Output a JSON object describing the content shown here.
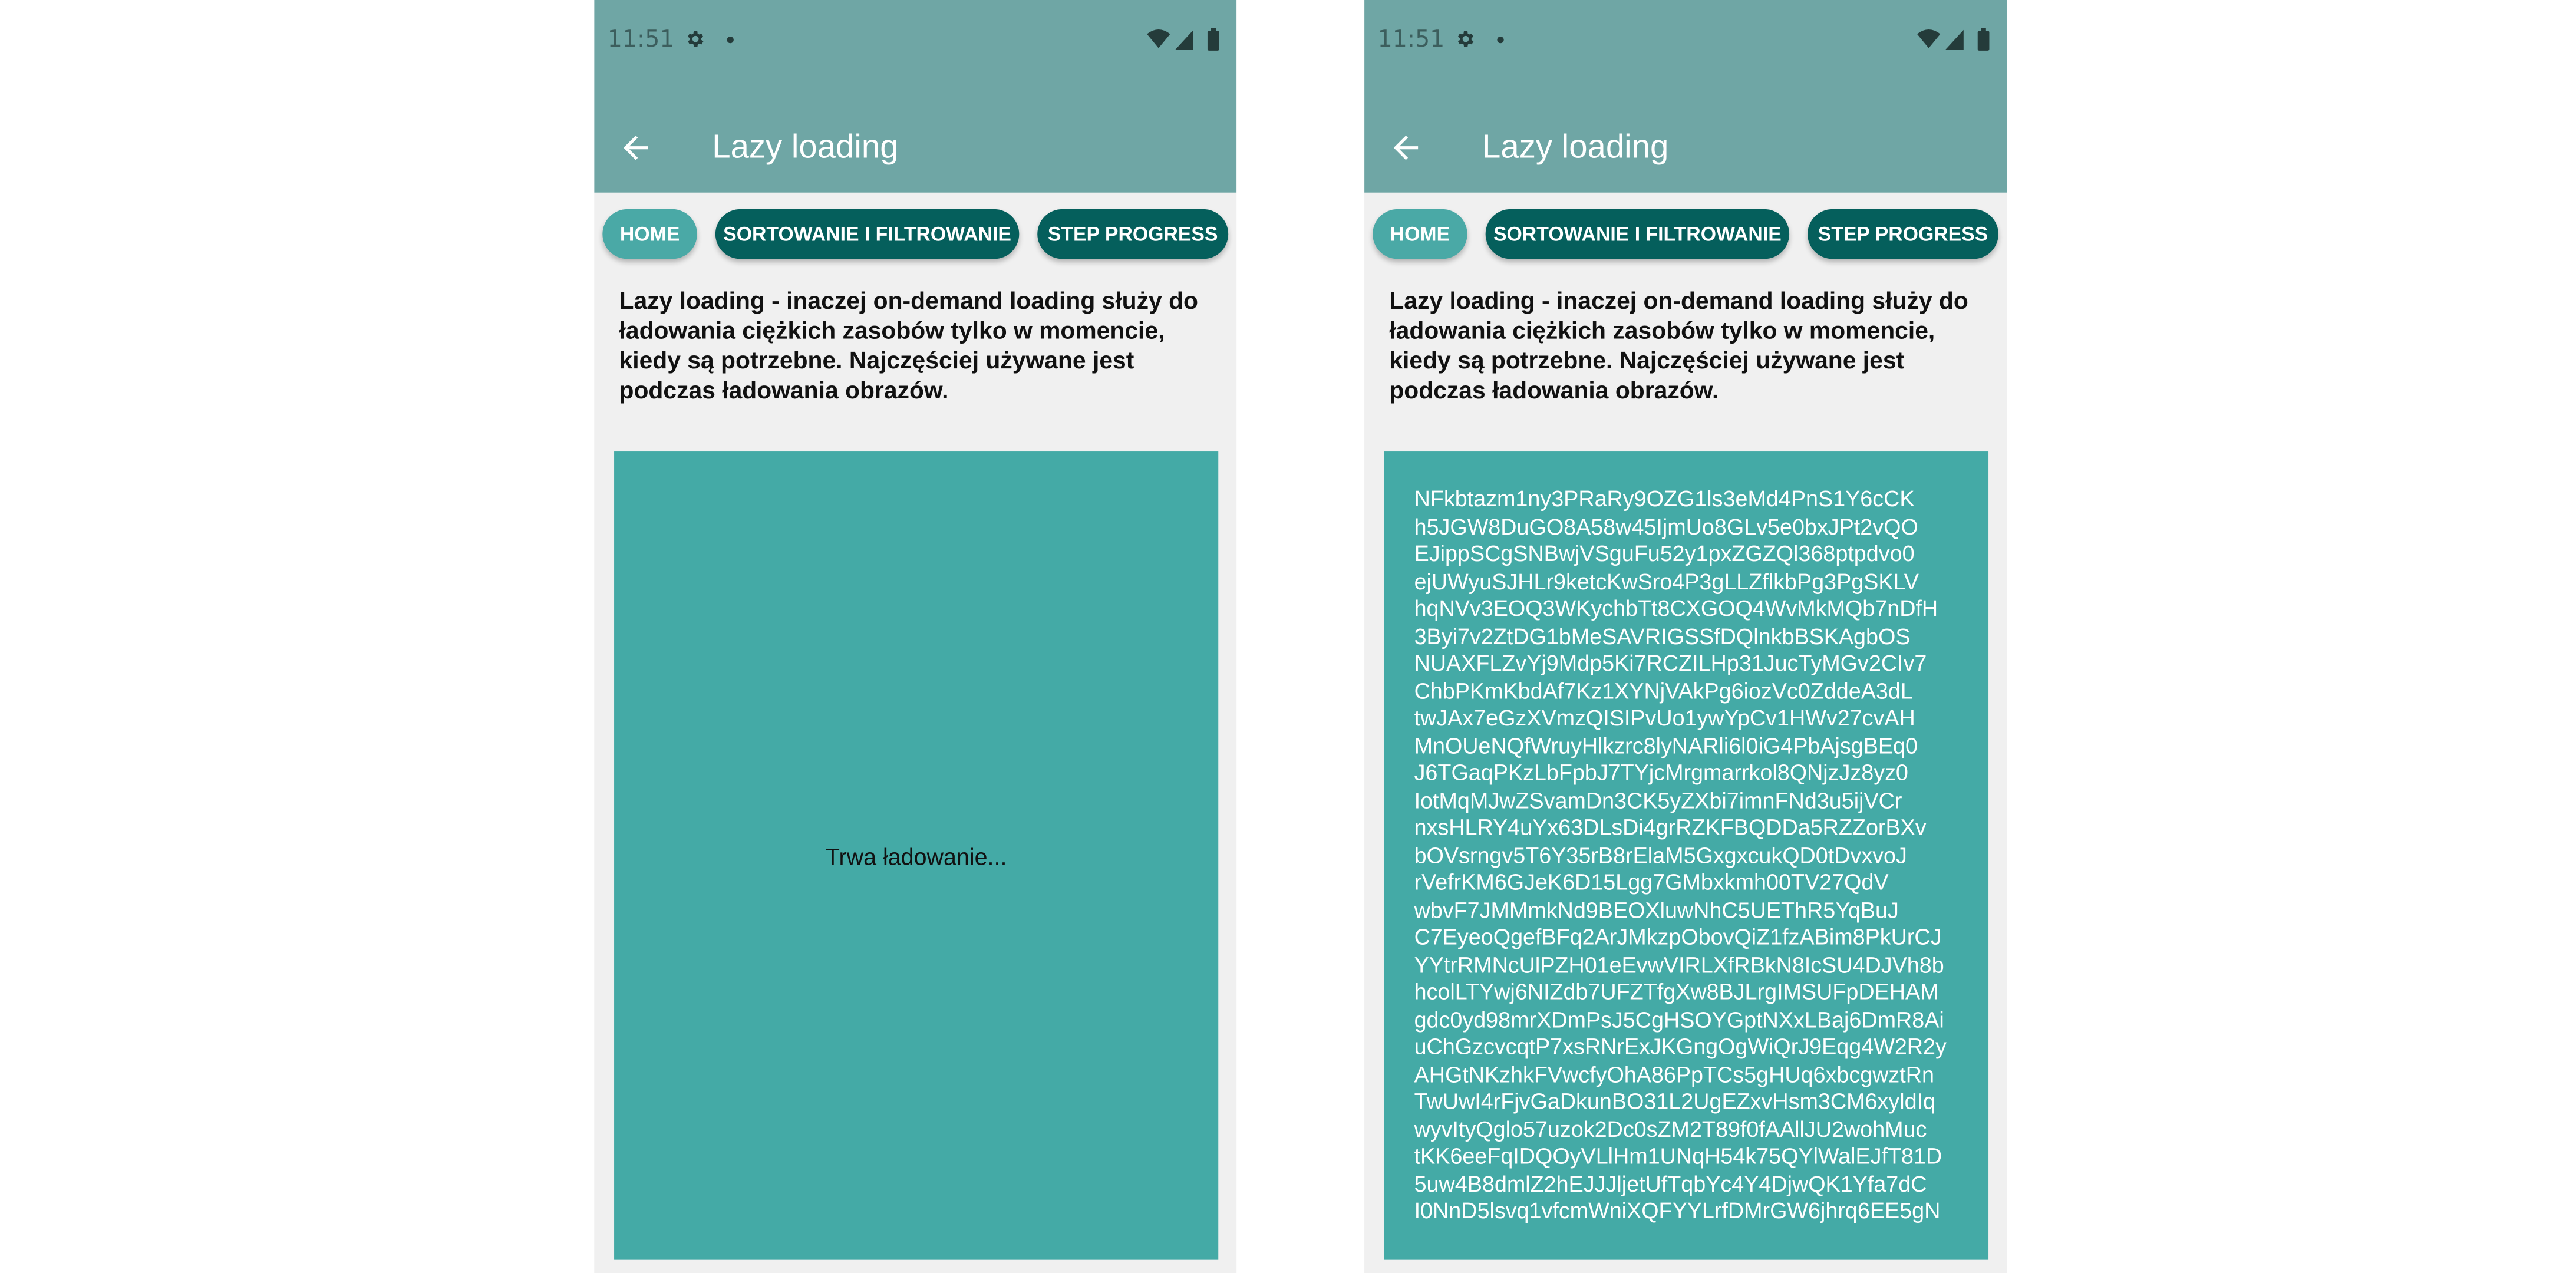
{
  "colors": {
    "status_bar": "#6fa6a5",
    "app_bar": "#6fa6a5",
    "chip_active": "#4aa9a6",
    "chip_inactive": "#055f5c",
    "content_box": "#44aaa6",
    "background": "#f0f0f0"
  },
  "icons": {
    "gear": "gear-icon",
    "notification_dot": "notification-dot-icon",
    "wifi": "wifi-icon",
    "signal": "signal-icon",
    "battery": "battery-icon",
    "back": "arrow-back-icon"
  },
  "left_phone": {
    "status": {
      "time": "11:51"
    },
    "app_bar": {
      "title": "Lazy loading"
    },
    "chips": [
      {
        "label": "HOME",
        "active": true
      },
      {
        "label": "SORTOWANIE I FILTROWANIE",
        "active": false
      },
      {
        "label": "STEP PROGRESS",
        "active": false
      }
    ],
    "description": "Lazy loading - inaczej on-demand loading służy do ładowania ciężkich zasobów tylko w momencie, kiedy są potrzebne. Najczęściej używane jest podczas ładowania obrazów.",
    "content": {
      "loading_text": "Trwa ładowanie..."
    }
  },
  "right_phone": {
    "status": {
      "time": "11:51"
    },
    "app_bar": {
      "title": "Lazy loading"
    },
    "chips": [
      {
        "label": "HOME",
        "active": true
      },
      {
        "label": "SORTOWANIE I FILTROWANIE",
        "active": false
      },
      {
        "label": "STEP PROGRESS",
        "active": false
      }
    ],
    "description": "Lazy loading - inaczej on-demand loading służy do ładowania ciężkich zasobów tylko w momencie, kiedy są potrzebne. Najczęściej używane jest podczas ładowania obrazów.",
    "content": {
      "lines": [
        " NFkbtazm1ny3PRaRy9OZG1ls3eMd4PnS1Y6cCK",
        "h5JGW8DuGO8A58w45IjmUo8GLv5e0bxJPt2vQO",
        "EJippSCgSNBwjVSguFu52y1pxZGZQl368ptpdvo0",
        "ejUWyuSJHLr9ketcKwSro4P3gLLZflkbPg3PgSKLV",
        "hqNVv3EOQ3WKychbTt8CXGOQ4WvMkMQb7nDfH",
        "3Byi7v2ZtDG1bMeSAVRIGSSfDQlnkbBSKAgbOS",
        "NUAXFLZvYj9Mdp5Ki7RCZILHp31JucTyMGv2CIv7",
        "ChbPKmKbdAf7Kz1XYNjVAkPg6iozVc0ZddeA3dL",
        "twJAx7eGzXVmzQISIPvUo1ywYpCv1HWv27cvAH",
        "MnOUeNQfWruyHlkzrc8lyNARli6l0iG4PbAjsgBEq0",
        "J6TGaqPKzLbFpbJ7TYjcMrgmarrkol8QNjzJz8yz0",
        "IotMqMJwZSvamDn3CK5yZXbi7imnFNd3u5ijVCr",
        "nxsHLRY4uYx63DLsDi4grRZKFBQDDa5RZZorBXv",
        "bOVsrngv5T6Y35rB8rElaM5GxgxcukQD0tDvxvoJ",
        "rVefrKM6GJeK6D15Lgg7GMbxkmh00TV27QdV",
        "wbvF7JMMmkNd9BEOXluwNhC5UEThR5YqBuJ",
        "C7EyeoQgefBFq2ArJMkzpObovQiZ1fzABim8PkUrCJ",
        "YYtrRMNcUlPZH01eEvwVIRLXfRBkN8IcSU4DJVh8b",
        "hcolLTYwj6NIZdb7UFZTfgXw8BJLrgIMSUFpDEHAM",
        "gdc0yd98mrXDmPsJ5CgHSOYGptNXxLBaj6DmR8Ai",
        "uChGzcvcqtP7xsRNrExJKGngOgWiQrJ9Eqg4W2R2y",
        "AHGtNKzhkFVwcfyOhA86PpTCs5gHUq6xbcgwztRn",
        "TwUwI4rFjvGaDkunBO31L2UgEZxvHsm3CM6xyldIq",
        "wyvItyQglo57uzok2Dc0sZM2T89f0fAAllJU2wohMuc",
        "tKK6eeFqIDQOyVLlHm1UNqH54k75QYlWalEJfT81D",
        "5uw4B8dmlZ2hEJJJljetUfTqbYc4Y4DjwQK1Yfa7dC",
        "I0NnD5lsvq1vfcmWniXQFYYLrfDMrGW6jhrq6EE5gN"
      ]
    }
  }
}
